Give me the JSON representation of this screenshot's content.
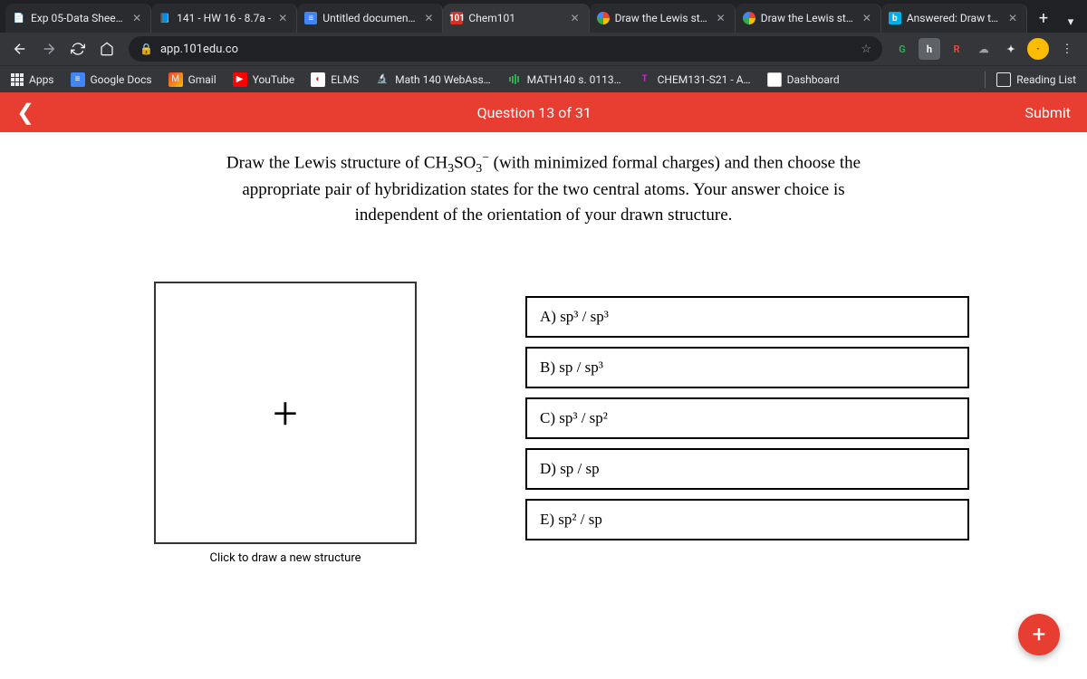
{
  "browser": {
    "tabs": [
      {
        "title": "Exp 05-Data Sheet.p"
      },
      {
        "title": "141 - HW 16 - 8.7a - "
      },
      {
        "title": "Untitled document - "
      },
      {
        "title": "Chem101"
      },
      {
        "title": "Draw the Lewis struc"
      },
      {
        "title": "Draw the Lewis struc"
      },
      {
        "title": "Answered: Draw the"
      }
    ],
    "url": "app.101edu.co",
    "bookmarks": {
      "apps": "Apps",
      "items": [
        "Google Docs",
        "Gmail",
        "YouTube",
        "ELMS",
        "Math 140 WebAss…",
        "MATH140 s. 0113…",
        "CHEM131-S21 - A…",
        "Dashboard"
      ],
      "reading_list": "Reading List"
    }
  },
  "app": {
    "question_label": "Question 13 of 31",
    "submit": "Submit",
    "prompt_html": "Draw the Lewis structure of CH<sub>3</sub>SO<sub>3</sub><sup>&#8722;</sup> (with minimized formal charges) and then choose the appropriate pair of hybridization states for the two central atoms. Your answer choice is independent of the orientation of your drawn structure.",
    "canvas_hint": "Click to draw a new structure",
    "choices": [
      "A) sp³ / sp³",
      "B) sp / sp³",
      "C) sp³ / sp²",
      "D) sp / sp",
      "E) sp² / sp"
    ],
    "fab": "+"
  }
}
